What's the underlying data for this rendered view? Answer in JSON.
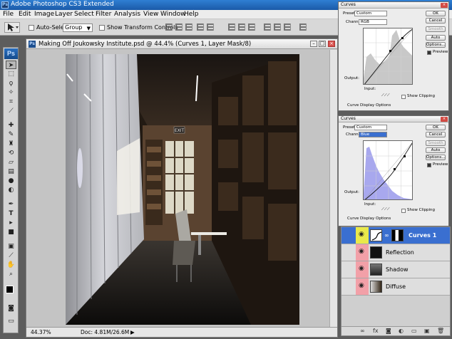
{
  "app": {
    "title": "Adobe Photoshop CS3 Extended"
  },
  "menu": [
    "File",
    "Edit",
    "Image",
    "Layer",
    "Select",
    "Filter",
    "Analysis",
    "View",
    "Window",
    "Help"
  ],
  "options_bar": {
    "auto_select_label": "Auto-Select:",
    "auto_select_value": "Group",
    "transform_label": "Show Transform Controls"
  },
  "toolbox": {
    "logo": "Ps",
    "tools": [
      "move-tool",
      "marquee-tool",
      "lasso-tool",
      "magic-wand-tool",
      "crop-tool",
      "slice-tool",
      "healing-brush-tool",
      "brush-tool",
      "clone-stamp-tool",
      "history-brush-tool",
      "eraser-tool",
      "gradient-tool",
      "blur-tool",
      "dodge-tool",
      "pen-tool",
      "type-tool",
      "path-selection-tool",
      "shape-tool",
      "notes-tool",
      "eyedropper-tool",
      "hand-tool",
      "zoom-tool"
    ]
  },
  "document": {
    "title": "Making Off Joukowsky Institute.psd @ 44.4% (Curves 1, Layer Mask/8)",
    "zoom": "44.37%",
    "doc_size": "Doc: 4.81M/26.6M",
    "render_labels": {
      "exit_sign": "EXIT"
    }
  },
  "curves_dialogs": [
    {
      "title": "Curves",
      "preset_label": "Preset:",
      "preset_value": "Custom",
      "channel_label": "Channel:",
      "channel_value": "RGB",
      "output_label": "Output:",
      "input_label": "Input:",
      "show_clipping": "Show Clipping",
      "display_options": "Curve Display Options",
      "buttons": [
        "OK",
        "Cancel",
        "Smooth",
        "Auto",
        "Options...",
        "Preview"
      ],
      "highlight_color": "#c8c8c8"
    },
    {
      "title": "Curves",
      "preset_label": "Preset:",
      "preset_value": "Custom",
      "channel_label": "Channel:",
      "channel_value": "Blue",
      "output_label": "Output:",
      "input_label": "Input:",
      "show_clipping": "Show Clipping",
      "display_options": "Curve Display Options",
      "buttons": [
        "OK",
        "Cancel",
        "Smooth",
        "Auto",
        "Options...",
        "Preview"
      ],
      "highlight_color": "#a8a8ee"
    }
  ],
  "layers": [
    {
      "name": "Curves 1",
      "active": true
    },
    {
      "name": "Reflection",
      "active": false
    },
    {
      "name": "Shadow",
      "active": false
    },
    {
      "name": "Diffuse",
      "active": false
    }
  ],
  "colors": {
    "accent": "#3a6fd0",
    "title_bar": "#2f7fd3",
    "background": "#5d5d5d"
  }
}
